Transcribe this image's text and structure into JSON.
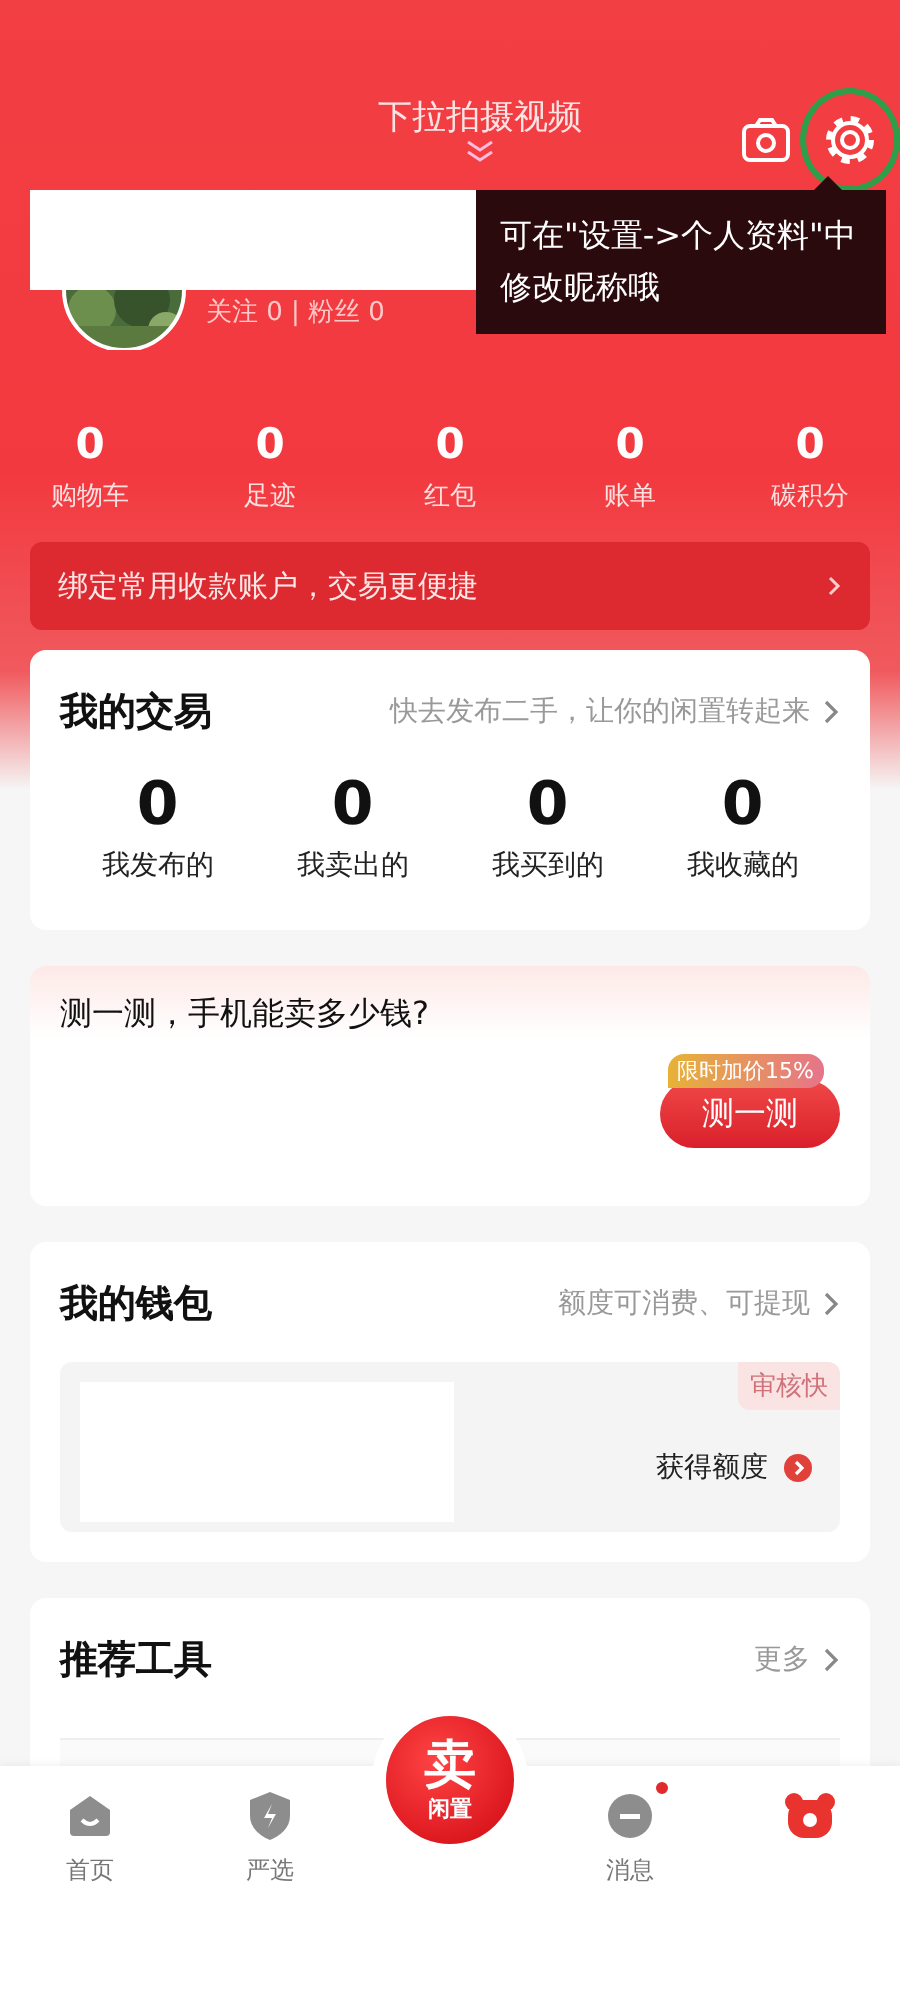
{
  "header": {
    "pull_hint": "下拉拍摄视频",
    "profile": {
      "follow_stats": "关注 0 | 粉丝 0"
    },
    "tooltip": "可在\"设置->个人资料\"中修改昵称哦",
    "settings_highlighted": true
  },
  "stats": [
    {
      "value": "0",
      "label": "购物车"
    },
    {
      "value": "0",
      "label": "足迹"
    },
    {
      "value": "0",
      "label": "红包"
    },
    {
      "value": "0",
      "label": "账单"
    },
    {
      "value": "0",
      "label": "碳积分"
    }
  ],
  "bind_banner": {
    "text": "绑定常用收款账户，交易更便捷"
  },
  "trades": {
    "title": "我的交易",
    "link": "快去发布二手，让你的闲置转起来",
    "items": [
      {
        "value": "0",
        "label": "我发布的"
      },
      {
        "value": "0",
        "label": "我卖出的"
      },
      {
        "value": "0",
        "label": "我买到的"
      },
      {
        "value": "0",
        "label": "我收藏的"
      }
    ]
  },
  "estimate": {
    "title": "测一测，手机能卖多少钱?",
    "badge": "限时加价15%",
    "button": "测一测"
  },
  "wallet": {
    "title": "我的钱包",
    "link": "额度可消费、可提现",
    "tag": "审核快",
    "action": "获得额度"
  },
  "tools": {
    "title": "推荐工具",
    "more": "更多"
  },
  "tab_bar": [
    {
      "kind": "home",
      "label": "首页",
      "selected": false
    },
    {
      "kind": "shield",
      "label": "严选",
      "selected": false
    },
    {
      "kind": "sell",
      "big": "卖",
      "label": "闲置",
      "selected": false
    },
    {
      "kind": "message",
      "label": "消息",
      "selected": false,
      "badge": true
    },
    {
      "kind": "profile",
      "selected": true
    }
  ]
}
